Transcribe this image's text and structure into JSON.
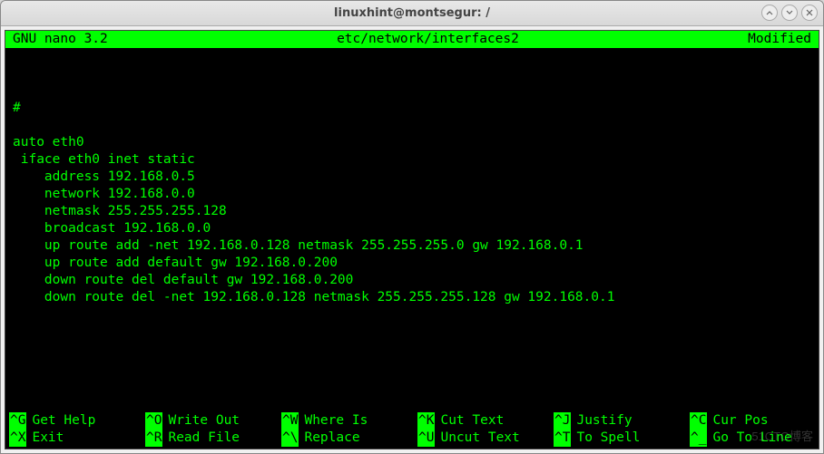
{
  "window": {
    "title": "linuxhint@montsegur: /"
  },
  "nano": {
    "header": {
      "version": "GNU nano 3.2",
      "file": "etc/network/interfaces2",
      "status": "Modified"
    },
    "lines": [
      "",
      "",
      "",
      "#",
      "",
      "auto eth0",
      " iface eth0 inet static",
      "    address 192.168.0.5",
      "    network 192.168.0.0",
      "    netmask 255.255.255.128",
      "    broadcast 192.168.0.0",
      "    up route add -net 192.168.0.128 netmask 255.255.255.0 gw 192.168.0.1",
      "    up route add default gw 192.168.0.200",
      "    down route del default gw 192.168.0.200",
      "    down route del -net 192.168.0.128 netmask 255.255.255.128 gw 192.168.0.1",
      "",
      "",
      ""
    ],
    "footer": {
      "row1": [
        {
          "key": "^G",
          "label": "Get Help"
        },
        {
          "key": "^O",
          "label": "Write Out"
        },
        {
          "key": "^W",
          "label": "Where Is"
        },
        {
          "key": "^K",
          "label": "Cut Text"
        },
        {
          "key": "^J",
          "label": "Justify"
        },
        {
          "key": "^C",
          "label": "Cur Pos"
        }
      ],
      "row2": [
        {
          "key": "^X",
          "label": "Exit"
        },
        {
          "key": "^R",
          "label": "Read File"
        },
        {
          "key": "^\\",
          "label": "Replace"
        },
        {
          "key": "^U",
          "label": "Uncut Text"
        },
        {
          "key": "^T",
          "label": "To Spell"
        },
        {
          "key": "^_",
          "label": "Go To Line"
        }
      ]
    }
  },
  "watermark": "51CTO博客"
}
